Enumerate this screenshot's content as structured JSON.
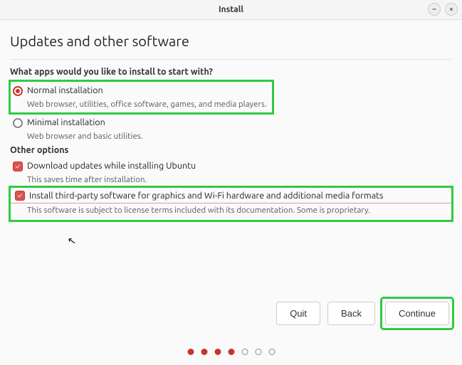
{
  "window": {
    "title": "Install"
  },
  "page": {
    "heading": "Updates and other software",
    "q_apps": "What apps would you like to install to start with?",
    "normal": {
      "label": "Normal installation",
      "desc": "Web browser, utilities, office software, games, and media players."
    },
    "minimal": {
      "label": "Minimal installation",
      "desc": "Web browser and basic utilities."
    },
    "other_title": "Other options",
    "download": {
      "label": "Download updates while installing Ubuntu",
      "desc": "This saves time after installation."
    },
    "thirdparty": {
      "label": "Install third-party software for graphics and Wi-Fi hardware and additional media formats",
      "desc": "This software is subject to license terms included with its documentation. Some is proprietary."
    }
  },
  "buttons": {
    "quit": "Quit",
    "back": "Back",
    "continue": "Continue"
  },
  "progress": {
    "total": 7,
    "current": 4
  }
}
